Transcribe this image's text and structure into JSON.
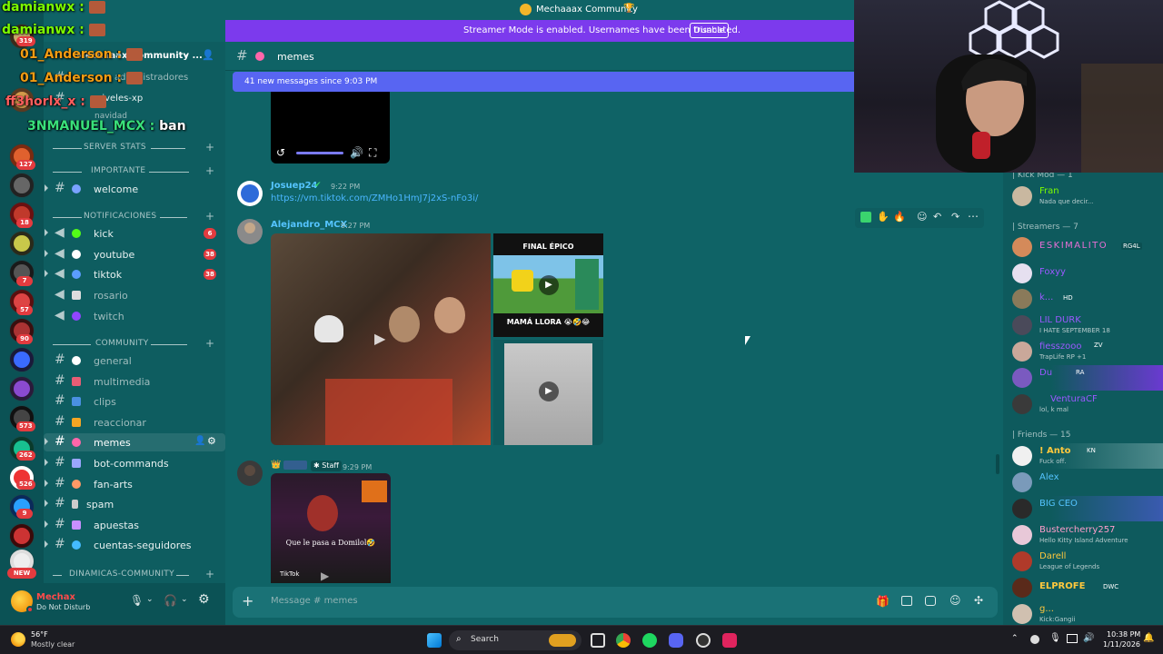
{
  "overlay_chat": [
    {
      "user": "damianwx :",
      "color": "#7CFC00"
    },
    {
      "user": "damianwx :",
      "color": "#7CFC00"
    },
    {
      "user": "01_Anderson :",
      "color": "#f39c12"
    },
    {
      "user": "01_Anderson :",
      "color": "#f39c12"
    },
    {
      "user": "ff3horlx_x :",
      "color": "#ff5e5e"
    },
    {
      "user": "3NMANUEL_MCX :",
      "color": "#39e07a",
      "text": "ban"
    }
  ],
  "title_bar": {
    "title": "Mechaaax Community"
  },
  "streamer_banner": {
    "text": "Streamer Mode is enabled. Usernames have been truncated.",
    "button": "Disable"
  },
  "server_rail": {
    "badges": [
      "319",
      "127",
      "18",
      "7",
      "57",
      "90",
      "573",
      "262",
      "526",
      "9"
    ],
    "new_label": "NEW"
  },
  "channel_sidebar": {
    "server_name": "Mechaaax Community ...",
    "top_items": [
      "administradores",
      "niveles-xp",
      "navidad"
    ],
    "categories": {
      "server_stats": "SERVER STATS",
      "importante": "IMPORTANTE",
      "notificaciones": "NOTIFICACIONES",
      "community": "COMMUNITY",
      "dinamicas": "DINAMICAS-COMMUNITY"
    },
    "channels": [
      {
        "name": "welcome",
        "emo": "#7aa2ff",
        "type": "hash"
      },
      {
        "name": "kick",
        "emo": "#53fc18",
        "type": "announce",
        "badge": "6"
      },
      {
        "name": "youtube",
        "emo": "#ffffff",
        "type": "announce",
        "badge": "38"
      },
      {
        "name": "tiktok",
        "emo": "#5b9dff",
        "type": "announce",
        "badge": "38"
      },
      {
        "name": "rosario",
        "emo": "#dddddd",
        "type": "announce",
        "dim": true
      },
      {
        "name": "twitch",
        "emo": "#9146ff",
        "type": "announce",
        "dim": true
      },
      {
        "name": "general",
        "emo": "#ffffff",
        "type": "hash",
        "dim": true
      },
      {
        "name": "multimedia",
        "emo": "#e85d75",
        "type": "hash",
        "dim": true
      },
      {
        "name": "clips",
        "emo": "#4a90e2",
        "type": "hash",
        "dim": true
      },
      {
        "name": "reaccionar",
        "emo": "#f5a623",
        "type": "hash",
        "dim": true
      },
      {
        "name": "memes",
        "emo": "#ff66aa",
        "type": "hash",
        "active": true
      },
      {
        "name": "bot-commands",
        "emo": "#9aa6ff",
        "type": "hash"
      },
      {
        "name": "fan-arts",
        "emo": "#ff9966",
        "type": "hash"
      },
      {
        "name": "spam",
        "emo": "#cccccc",
        "type": "hash"
      },
      {
        "name": "apuestas",
        "emo": "#c78fff",
        "type": "hash"
      },
      {
        "name": "cuentas-seguidores",
        "emo": "#44bbff",
        "type": "hash"
      }
    ]
  },
  "user_panel": {
    "name": "Mechax",
    "status": "Do Not Disturb"
  },
  "channel_header": {
    "name": "memes"
  },
  "new_messages_bar": {
    "text": "41 new messages since 9:03 PM"
  },
  "messages": [
    {
      "user": "Josuep24",
      "time": "9:22 PM",
      "link": "https://vm.tiktok.com/ZMHo1HmJ7j2xS-nFo3i/",
      "color": "#55c4ff"
    },
    {
      "user": "Alejandro_MCX",
      "time": "9:27 PM",
      "color": "#55c4ff",
      "media_labels": {
        "top": "FINAL ÉPICO",
        "bottom": "MAMÁ LLORA 😭🤣😂"
      }
    },
    {
      "user": "",
      "role": "Staff",
      "time": "9:29 PM",
      "caption": "Que le pasa a Domilol🤣",
      "watermark": "TikTok"
    }
  ],
  "composer": {
    "placeholder": "Message #  memes"
  },
  "member_list": {
    "groups": [
      "| Kick Mod — 1",
      "| Streamers — 7",
      "| Friends — 15"
    ],
    "members": [
      {
        "name": "Fran",
        "status": "Nada que decir...",
        "color": "#7CFC00"
      },
      {
        "name": "ESKIMALITO",
        "tag": "RG4L",
        "color": "#e96fd6"
      },
      {
        "name": "Foxyy",
        "color": "#9b59ff"
      },
      {
        "name": "k...",
        "tag": "HD",
        "color": "#9b59ff"
      },
      {
        "name": "LIL DURK",
        "status": "I HATE SEPTEMBER 18",
        "color": "#9b59ff"
      },
      {
        "name": "fiesszooo",
        "tag": "ZV",
        "status": "TrapLife RP +1",
        "color": "#9b59ff"
      },
      {
        "name": "Du",
        "tag": "RA",
        "color": "#9b59ff"
      },
      {
        "name": "VenturaCF",
        "status": "lol, k mal",
        "color": "#9b59ff"
      },
      {
        "name": "! Anto",
        "tag": "KN",
        "status": "Fuck off.",
        "color": "#ffc83d"
      },
      {
        "name": "Alex",
        "color": "#55c4ff"
      },
      {
        "name": "BIG CEO",
        "color": "#55c4ff"
      },
      {
        "name": "Bustercherry257",
        "status": "Hello Kitty Island Adventure",
        "color": "#ff9ecb"
      },
      {
        "name": "Darell",
        "status": "League of Legends",
        "color": "#ffc83d"
      },
      {
        "name": "ELPROFE",
        "tag": "DWC",
        "color": "#ffc83d"
      },
      {
        "name": "g...",
        "status": "Kick:Gangii",
        "color": "#ffc83d"
      }
    ]
  },
  "taskbar": {
    "weather_temp": "56°F",
    "weather_desc": "Mostly clear",
    "search": "Search",
    "time": "10:38 PM",
    "date": "1/11/2026"
  }
}
